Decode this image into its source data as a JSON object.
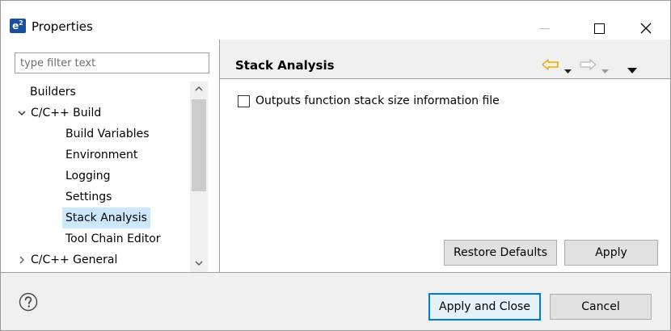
{
  "window": {
    "title": "Properties",
    "app_icon_label": "e",
    "app_icon_sup": "2"
  },
  "filter": {
    "placeholder": "type filter text",
    "value": ""
  },
  "tree": {
    "items": [
      {
        "label": "Builders",
        "level": 1
      },
      {
        "label": "C/C++ Build",
        "level": 0,
        "expanded": true
      },
      {
        "label": "Build Variables",
        "level": 2
      },
      {
        "label": "Environment",
        "level": 2
      },
      {
        "label": "Logging",
        "level": 2
      },
      {
        "label": "Settings",
        "level": 2
      },
      {
        "label": "Stack Analysis",
        "level": 2,
        "selected": true
      },
      {
        "label": "Tool Chain Editor",
        "level": 2
      },
      {
        "label": "C/C++ General",
        "level": 0,
        "expanded": false
      }
    ]
  },
  "page": {
    "title": "Stack Analysis",
    "option_label": "Outputs function stack size information file",
    "option_checked": false,
    "restore_label": "Restore Defaults",
    "apply_label": "Apply"
  },
  "footer": {
    "apply_close_label": "Apply and Close",
    "cancel_label": "Cancel"
  },
  "colors": {
    "selection": "#cce8ff",
    "focus_border": "#0078d7",
    "back_arrow": "#e8a317",
    "app_icon": "#1a4fa0"
  },
  "icons": [
    "app-icon",
    "minimize-icon",
    "maximize-icon",
    "close-icon",
    "chevron-up-icon",
    "chevron-down-icon",
    "back-arrow-icon",
    "forward-arrow-icon",
    "help-icon"
  ]
}
